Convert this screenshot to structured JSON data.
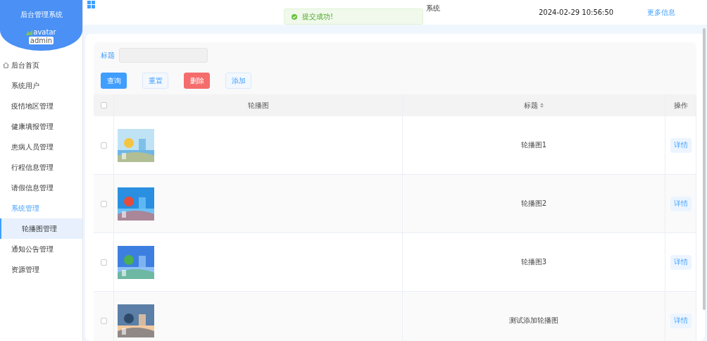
{
  "sidebar": {
    "app_title": "后台管理系统",
    "avatar_alt": "avatar",
    "username": "admin",
    "items": [
      {
        "label": "后台首页",
        "kind": "home",
        "selected": false,
        "expanded": false
      },
      {
        "label": "系统用户",
        "kind": "plain",
        "selected": false,
        "expanded": false
      },
      {
        "label": "疫情地区管理",
        "kind": "plain",
        "selected": false,
        "expanded": false
      },
      {
        "label": "健康填报管理",
        "kind": "plain",
        "selected": false,
        "expanded": false
      },
      {
        "label": "患病人员管理",
        "kind": "plain",
        "selected": false,
        "expanded": false
      },
      {
        "label": "行程信息管理",
        "kind": "plain",
        "selected": false,
        "expanded": false
      },
      {
        "label": "请假信息管理",
        "kind": "plain",
        "selected": false,
        "expanded": false
      },
      {
        "label": "系统管理",
        "kind": "plain",
        "selected": false,
        "expanded": true,
        "children": [
          {
            "label": "轮播图管理",
            "selected": true
          }
        ]
      },
      {
        "label": "通知公告管理",
        "kind": "plain",
        "selected": false,
        "expanded": false
      },
      {
        "label": "资源管理",
        "kind": "plain",
        "selected": false,
        "expanded": false
      }
    ]
  },
  "header": {
    "title": "系统",
    "datetime": "2024-02-29 10:56:50",
    "more_link": "更多信息"
  },
  "toast": {
    "kind": "success",
    "message": "提交成功!"
  },
  "search": {
    "label": "标题"
  },
  "buttons": [
    {
      "label": "查询",
      "kind": "primary"
    },
    {
      "label": "重置",
      "kind": "plain"
    },
    {
      "label": "删除",
      "kind": "danger"
    },
    {
      "label": "添加",
      "kind": "plain"
    }
  ],
  "table": {
    "all_checked": false,
    "columns": [
      {
        "label": "轮播图",
        "sortable": false
      },
      {
        "label": "标题",
        "sortable": true
      },
      {
        "label": "操作",
        "sortable": false
      }
    ],
    "rows": [
      {
        "checked": false,
        "title": "轮播图1",
        "action": "详情"
      },
      {
        "checked": false,
        "title": "轮播图2",
        "action": "详情"
      },
      {
        "checked": false,
        "title": "轮播图3",
        "action": "详情"
      },
      {
        "checked": false,
        "title": "测试添加轮播图",
        "action": "详情"
      }
    ]
  }
}
